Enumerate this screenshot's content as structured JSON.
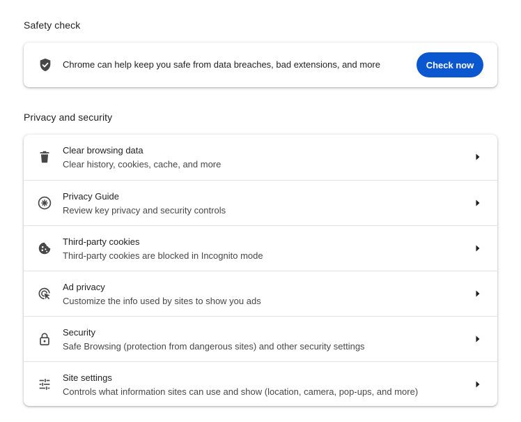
{
  "safety_check": {
    "title": "Safety check",
    "description": "Chrome can help keep you safe from data breaches, bad extensions, and more",
    "button_label": "Check now",
    "icon": "shield-check-icon"
  },
  "privacy": {
    "title": "Privacy and security",
    "items": [
      {
        "title": "Clear browsing data",
        "subtitle": "Clear history, cookies, cache, and more",
        "icon": "trash-icon"
      },
      {
        "title": "Privacy Guide",
        "subtitle": "Review key privacy and security controls",
        "icon": "privacy-guide-icon"
      },
      {
        "title": "Third-party cookies",
        "subtitle": "Third-party cookies are blocked in Incognito mode",
        "icon": "cookie-icon"
      },
      {
        "title": "Ad privacy",
        "subtitle": "Customize the info used by sites to show you ads",
        "icon": "ad-privacy-icon"
      },
      {
        "title": "Security",
        "subtitle": "Safe Browsing (protection from dangerous sites) and other security settings",
        "icon": "lock-icon"
      },
      {
        "title": "Site settings",
        "subtitle": "Controls what information sites can use and show (location, camera, pop-ups, and more)",
        "icon": "tune-icon"
      }
    ]
  },
  "colors": {
    "accent": "#0b57d0",
    "icon": "#474747",
    "divider": "#e3e3e3"
  }
}
